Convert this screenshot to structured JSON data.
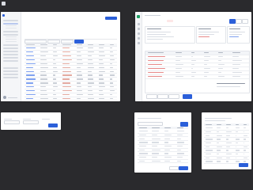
{
  "colors": {
    "background": "#2a2a2d",
    "accent": "#2b5fd9",
    "success": "#1f9d61",
    "danger": "#e78a8a"
  },
  "desktop": {
    "app_icon": "app-icon"
  },
  "list_window": {
    "brand": "",
    "title": "",
    "primary_button": "",
    "stats": [
      {
        "label": "",
        "value": ""
      },
      {
        "label": "",
        "value": ""
      },
      {
        "label": "",
        "value": ""
      },
      {
        "label": "",
        "value": ""
      }
    ],
    "tabs": [
      "",
      "",
      "",
      "",
      ""
    ],
    "active_tab_index": 0,
    "row_count": 16
  },
  "detail_window": {
    "title": "",
    "status_badge": "",
    "section_title": "",
    "row_count": 6
  },
  "dialog_small": {
    "title": ""
  },
  "dialog_table_a": {
    "title": "",
    "row_count": 9
  },
  "dialog_table_b": {
    "title": "",
    "row_count": 10
  }
}
